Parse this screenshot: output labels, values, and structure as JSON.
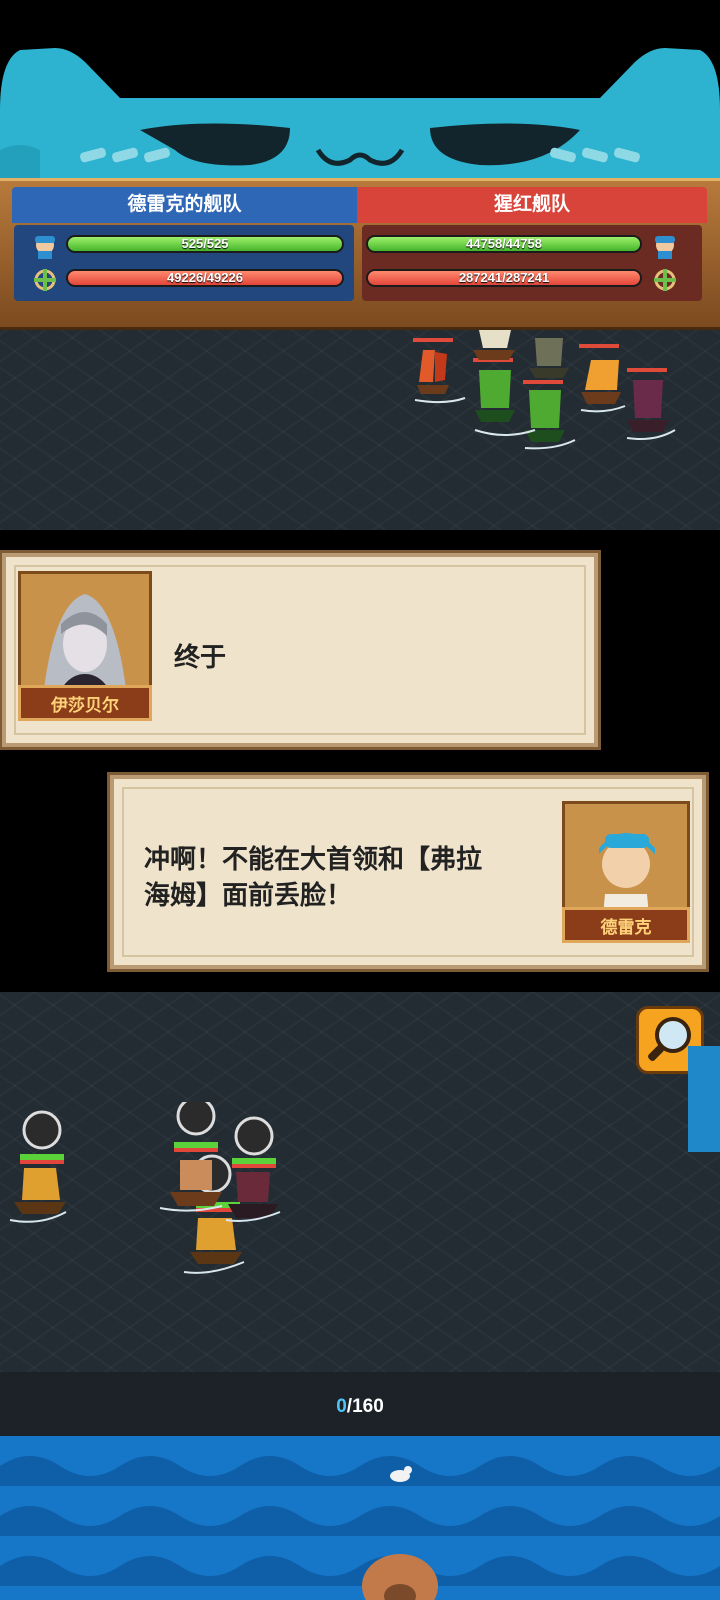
{
  "teams": {
    "left": {
      "name": "德雷克的舰队",
      "crew_text": "525/525",
      "crew_fraction": 1.0,
      "hull_text": "49226/49226",
      "hull_fraction": 1.0
    },
    "right": {
      "name": "猩红舰队",
      "crew_text": "44758/44758",
      "crew_fraction": 1.0,
      "hull_text": "287241/287241",
      "hull_fraction": 1.0
    }
  },
  "dialogs": [
    {
      "speaker": "伊莎贝尔",
      "text": "终于"
    },
    {
      "speaker": "德雷克",
      "text_line1": "冲啊！不能在大首领和【弗拉",
      "text_line2": "海姆】面前丢脸！"
    }
  ],
  "counter": {
    "current": "0",
    "total": "/160"
  },
  "colors": {
    "blue_team": "#2e67b5",
    "red_team": "#d9443a",
    "sea": "#232b33",
    "dialog_bg": "#efe3cb",
    "accent_counter": "#4fc3f7"
  },
  "icons": [
    "sailor-icon",
    "ship-wheel-icon",
    "magnifier-icon",
    "seagull-icon"
  ]
}
